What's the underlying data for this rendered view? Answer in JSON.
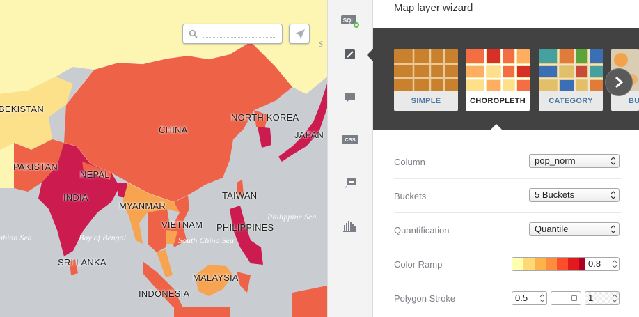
{
  "map": {
    "labels": {
      "uzbekistan": "BEKISTAN",
      "china": "CHINA",
      "north_korea": "NORTH KOREA",
      "japan": "JAPAN",
      "pakistan": "PAKISTAN",
      "nepal": "NEPAL",
      "india": "INDIA",
      "myanmar": "MYANMAR",
      "taiwan": "TAIWAN",
      "vietnam": "VIETNAM",
      "philippines": "PHILIPPINES",
      "sri_lanka": "SRI LANKA",
      "malaysia": "MALAYSIA",
      "indonesia": "INDONESIA"
    },
    "seas": {
      "arabian": "abian Sea",
      "bengal": "Bay of Bengal",
      "south_china": "South China Sea",
      "philippine": "Philippine Sea",
      "edge": "S"
    },
    "search_placeholder": "",
    "colors": {
      "water": "#c9cdd1",
      "land_neutral": "#fdf6b2",
      "land_light": "#fde08a",
      "land_orange": "#f7a451",
      "land_red": "#ee6248",
      "land_deep": "#cc1b4e"
    }
  },
  "toolstrip": {
    "items": [
      {
        "icon": "sql-icon",
        "text": "SQL"
      },
      {
        "icon": "wizard-brush-icon"
      },
      {
        "icon": "infowindow-icon"
      },
      {
        "icon": "css-icon",
        "text": "CSS"
      },
      {
        "icon": "legend-icon"
      },
      {
        "icon": "filters-icon"
      }
    ]
  },
  "panel": {
    "title": "Map layer wizard",
    "wizards": [
      {
        "label": "SIMPLE"
      },
      {
        "label": "CHOROPLETH"
      },
      {
        "label": "CATEGORY"
      },
      {
        "label": "BU"
      }
    ],
    "selected_wizard": "CHOROPLETH",
    "rows": {
      "column": {
        "label": "Column",
        "value": "pop_norm"
      },
      "buckets": {
        "label": "Buckets",
        "value": "5 Buckets"
      },
      "quantification": {
        "label": "Quantification",
        "value": "Quantile"
      },
      "color_ramp": {
        "label": "Color Ramp",
        "opacity": "0.8",
        "colors": [
          "#ffffb2",
          "#fed976",
          "#feb24c",
          "#fd8d3c",
          "#fc4e2a",
          "#e31a1c",
          "#b10026"
        ]
      },
      "polygon_stroke": {
        "label": "Polygon Stroke",
        "width": "0.5",
        "opacity": "1"
      }
    }
  }
}
